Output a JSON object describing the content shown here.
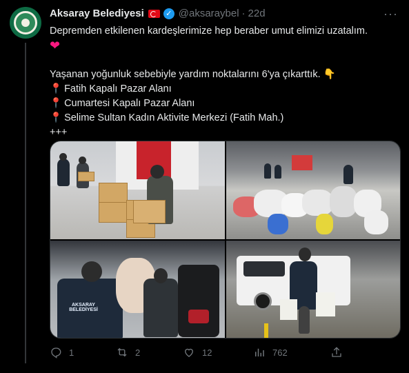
{
  "tweet": {
    "author_name": "Aksaray Belediyesi",
    "author_handle": "@aksaraybel",
    "separator": "·",
    "time": "22d",
    "more_glyph": "···",
    "lines": [
      "Depremden etkilenen kardeşlerimize hep beraber umut elimizi uzatalım.",
      "❤",
      "",
      "Yaşanan yoğunluk sebebiyle yardım noktalarını 6'ya çıkarttık. 👇",
      "Fatih Kapalı Pazar Alanı",
      "Cumartesi Kapalı Pazar Alanı",
      "Selime Sultan Kadın Aktivite Merkezi (Fatih Mah.)",
      "+++"
    ],
    "pin_glyph": "📍",
    "photo_text": "AKSARAY BELEDİYESİ"
  },
  "actions": {
    "reply_count": "1",
    "retweet_count": "2",
    "like_count": "12",
    "views_count": "762"
  },
  "icons": {
    "reply": "reply-icon",
    "retweet": "retweet-icon",
    "like": "heart-icon",
    "views": "views-icon",
    "share": "share-icon",
    "verified": "verified-badge-icon",
    "flag": "turkey-flag-icon"
  },
  "colors": {
    "background": "#000000",
    "text": "#e7e9ea",
    "muted": "#71767b",
    "verified": "#1d9bf0",
    "heart": "#f91880"
  }
}
